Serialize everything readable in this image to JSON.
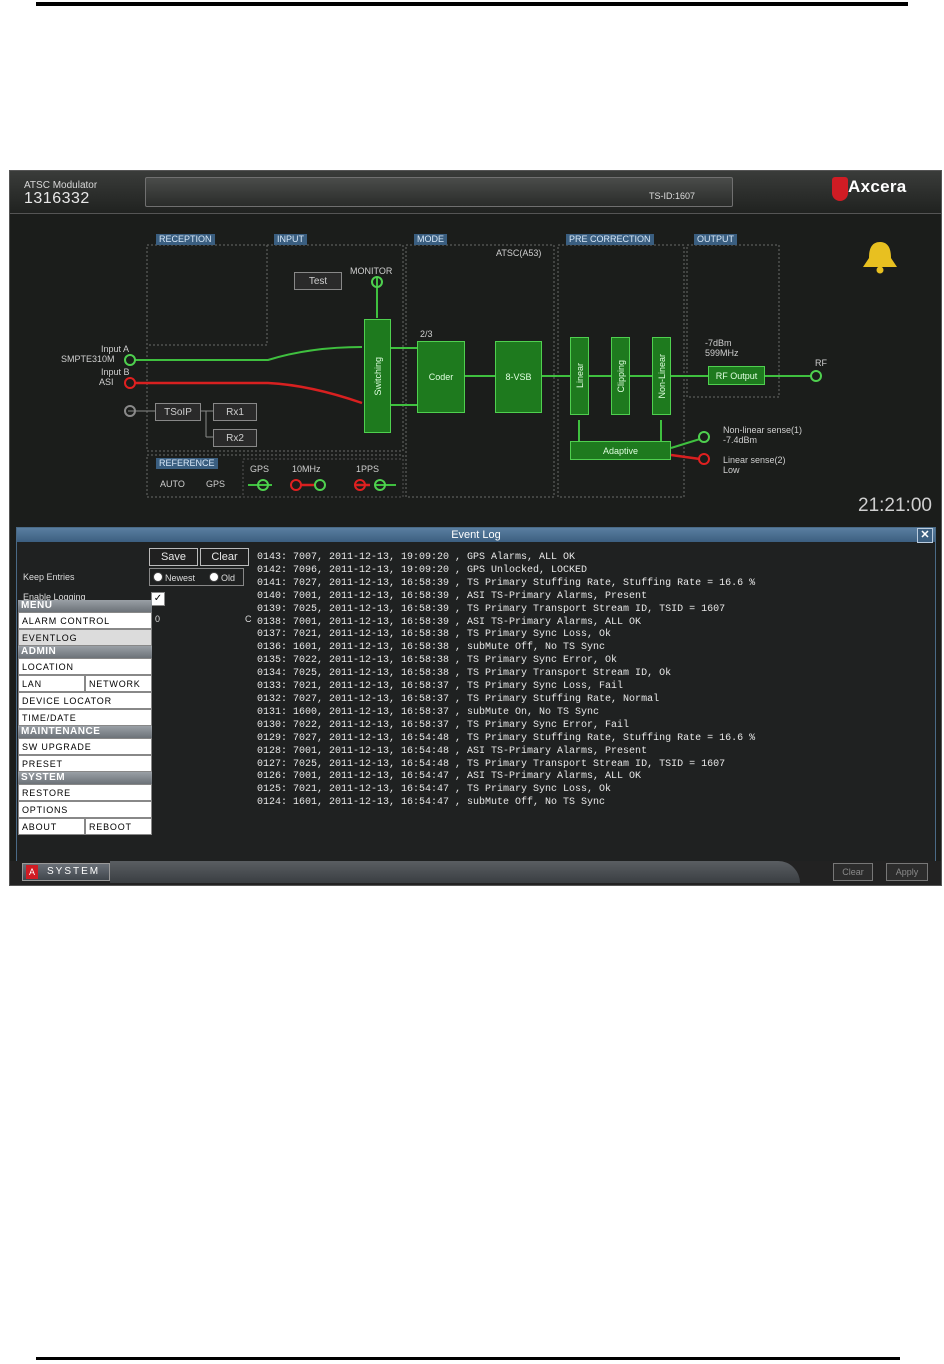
{
  "header": {
    "app_name": "ATSC Modulator",
    "serial": "1316332",
    "tsid": "TS-ID:1607",
    "logo": "Axcera"
  },
  "diagram": {
    "sections": {
      "reception": "RECEPTION",
      "input": "INPUT",
      "mode": "MODE",
      "pre_correction": "PRE CORRECTION",
      "output": "OUTPUT",
      "reference": "REFERENCE"
    },
    "test_button": "Test",
    "monitor": "MONITOR",
    "input_a": "Input A",
    "input_a_type": "SMPTE310M",
    "input_b": "Input B",
    "input_b_type": "ASI",
    "tsoip": "TSoIP",
    "rx1": "Rx1",
    "rx2": "Rx2",
    "switching": "Switching",
    "mode_label": "ATSC(A53)",
    "coder_rate": "2/3",
    "coder": "Coder",
    "vsb": "8-VSB",
    "linear": "Linear",
    "clipping": "Clipping",
    "nonlinear": "Non-Linear",
    "adaptive": "Adaptive",
    "output_power": "-7dBm",
    "output_freq": "599MHz",
    "rf_output": "RF Output",
    "rf": "RF",
    "nonlinear_sense": "Non-linear sense(1)",
    "nonlinear_sense_value": "-7.4dBm",
    "linear_sense": "Linear sense(2)",
    "linear_sense_value": "Low",
    "ref_auto": "AUTO",
    "ref_gps": "GPS",
    "ref_gps2": "GPS",
    "ref_10mhz": "10MHz",
    "ref_1pps": "1PPS",
    "clock": "21:21:00",
    "colors": {
      "green": "#4fd04f",
      "red": "#e02020",
      "bell": "#e8c020"
    }
  },
  "event_log": {
    "title": "Event Log",
    "close": "✕",
    "save": "Save",
    "clear": "Clear",
    "keep_entries": "Keep Entries",
    "newest": "Newest",
    "old": "Old",
    "enable_logging": "Enable Logging",
    "zero": "0",
    "cmark": "C",
    "entries": [
      "0143: 7007, 2011-12-13, 19:09:20 , GPS Alarms, ALL OK",
      "0142: 7096, 2011-12-13, 19:09:20 , GPS Unlocked, LOCKED",
      "0141: 7027, 2011-12-13, 16:58:39 , TS Primary Stuffing Rate, Stuffing Rate = 16.6 %",
      "0140: 7001, 2011-12-13, 16:58:39 , ASI TS-Primary Alarms, Present",
      "0139: 7025, 2011-12-13, 16:58:39 , TS Primary Transport Stream ID, TSID = 1607",
      "0138: 7001, 2011-12-13, 16:58:39 , ASI TS-Primary Alarms, ALL OK",
      "0137: 7021, 2011-12-13, 16:58:38 , TS Primary Sync Loss, Ok",
      "0136: 1601, 2011-12-13, 16:58:38 , subMute Off, No TS Sync",
      "0135: 7022, 2011-12-13, 16:58:38 , TS Primary Sync Error, Ok",
      "0134: 7025, 2011-12-13, 16:58:38 , TS Primary Transport Stream ID, Ok",
      "0133: 7021, 2011-12-13, 16:58:37 , TS Primary Sync Loss, Fail",
      "0132: 7027, 2011-12-13, 16:58:37 , TS Primary Stuffing Rate, Normal",
      "0131: 1600, 2011-12-13, 16:58:37 , subMute On, No TS Sync",
      "0130: 7022, 2011-12-13, 16:58:37 , TS Primary Sync Error, Fail",
      "0129: 7027, 2011-12-13, 16:54:48 , TS Primary Stuffing Rate, Stuffing Rate = 16.6 %",
      "0128: 7001, 2011-12-13, 16:54:48 , ASI TS-Primary Alarms, Present",
      "0127: 7025, 2011-12-13, 16:54:48 , TS Primary Transport Stream ID, TSID = 1607",
      "0126: 7001, 2011-12-13, 16:54:47 , ASI TS-Primary Alarms, ALL OK",
      "0125: 7021, 2011-12-13, 16:54:47 , TS Primary Sync Loss, Ok",
      "0124: 1601, 2011-12-13, 16:54:47 , subMute Off, No TS Sync"
    ]
  },
  "menu": {
    "menu_head": "MENU",
    "alarm_control": "ALARM CONTROL",
    "eventlog": "EVENTLOG",
    "admin_head": "ADMIN",
    "location": "LOCATION",
    "lan": "LAN",
    "network": "NETWORK",
    "device_locator": "DEVICE LOCATOR",
    "time_date": "TIME/DATE",
    "maintenance_head": "MAINTENANCE",
    "sw_upgrade": "SW UPGRADE",
    "preset": "PRESET",
    "system_head": "SYSTEM",
    "restore": "RESTORE",
    "options": "OPTIONS",
    "about": "ABOUT",
    "reboot": "REBOOT"
  },
  "bottombar": {
    "system_tab": "SYSTEM",
    "system_icon": "A",
    "clear": "Clear",
    "apply": "Apply"
  }
}
